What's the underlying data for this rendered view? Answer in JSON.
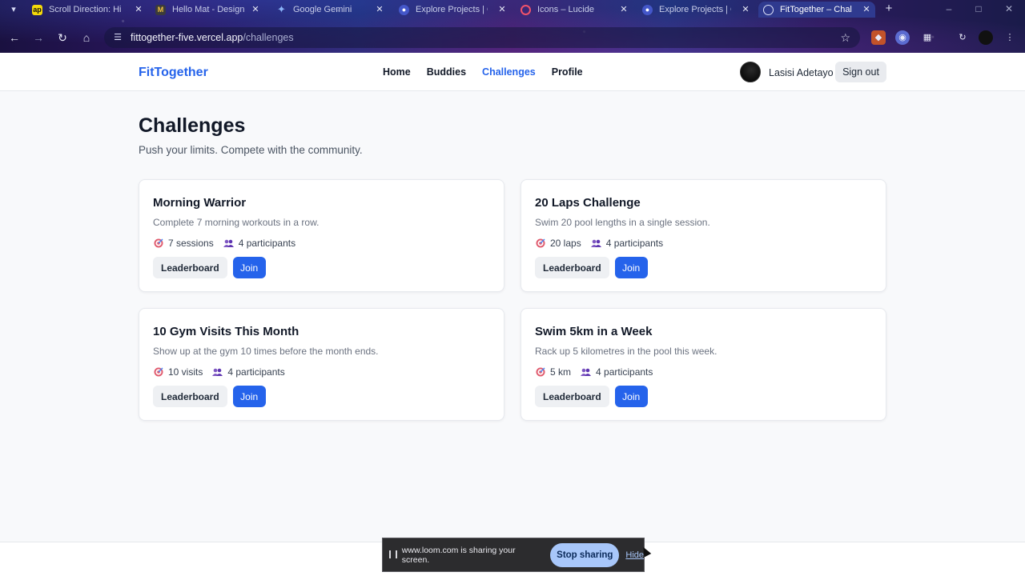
{
  "browser": {
    "tabs": [
      {
        "title": "Scroll Direction: Hide",
        "favicon": "yellow-app-icon",
        "active": false
      },
      {
        "title": "Hello Mat - Design a",
        "favicon": "m-icon",
        "active": false
      },
      {
        "title": "Google Gemini",
        "favicon": "gemini-icon",
        "active": false
      },
      {
        "title": "Explore Projects | Cy",
        "favicon": "globe-icon",
        "active": false
      },
      {
        "title": "Icons – Lucide",
        "favicon": "lucide-icon",
        "active": false
      },
      {
        "title": "Explore Projects | Cy",
        "favicon": "globe-icon",
        "active": false
      },
      {
        "title": "FitTogether – Challe",
        "favicon": "globe-icon",
        "active": true
      }
    ],
    "url_host": "fittogether-five.vercel.app",
    "url_path": "/challenges"
  },
  "header": {
    "brand": "FitTogether",
    "nav": [
      "Home",
      "Buddies",
      "Challenges",
      "Profile"
    ],
    "current_nav": "Challenges",
    "user_name": "Lasisi Adetayo",
    "sign_out": "Sign out"
  },
  "main": {
    "title": "Challenges",
    "subtitle": "Push your limits. Compete with the community."
  },
  "challenges": [
    {
      "title": "Morning Warrior",
      "description": "Complete 7 morning workouts in a row.",
      "goal": "7 sessions",
      "participants": "4 participants",
      "leaderboard_label": "Leaderboard",
      "join_label": "Join"
    },
    {
      "title": "20 Laps Challenge",
      "description": "Swim 20 pool lengths in a single session.",
      "goal": "20 laps",
      "participants": "4 participants",
      "leaderboard_label": "Leaderboard",
      "join_label": "Join"
    },
    {
      "title": "10 Gym Visits This Month",
      "description": "Show up at the gym 10 times before the month ends.",
      "goal": "10 visits",
      "participants": "4 participants",
      "leaderboard_label": "Leaderboard",
      "join_label": "Join"
    },
    {
      "title": "Swim 5km in a Week",
      "description": "Rack up 5 kilometres in the pool this week.",
      "goal": "5 km",
      "participants": "4 participants",
      "leaderboard_label": "Leaderboard",
      "join_label": "Join"
    }
  ],
  "share_bar": {
    "message": "www.loom.com is sharing your screen.",
    "stop_label": "Stop sharing",
    "hide_label": "Hide"
  },
  "colors": {
    "brand": "#2563eb",
    "join_button": "#2563eb",
    "stop_button": "#a8c7fa"
  }
}
